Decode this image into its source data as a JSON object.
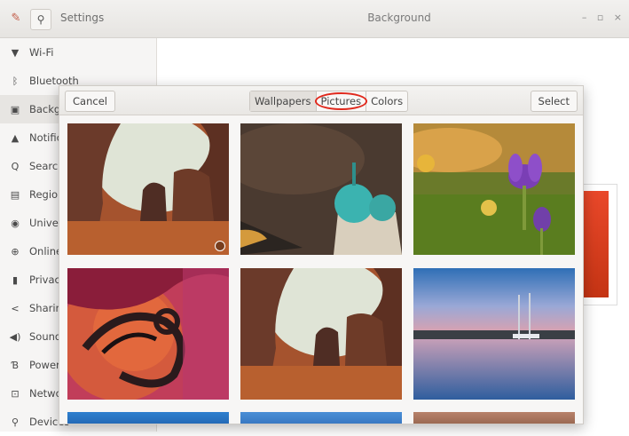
{
  "window": {
    "settings_title": "Settings",
    "title": "Background",
    "controls": "– ▫ ×"
  },
  "sidebar": {
    "items": [
      {
        "label": "Wi-Fi",
        "icon": "wifi-icon"
      },
      {
        "label": "Bluetooth",
        "icon": "bluetooth-icon"
      },
      {
        "label": "Backgr",
        "icon": "background-icon"
      },
      {
        "label": "Notific",
        "icon": "bell-icon"
      },
      {
        "label": "Search",
        "icon": "search-icon"
      },
      {
        "label": "Region",
        "icon": "keyboard-icon"
      },
      {
        "label": "Univer",
        "icon": "accessibility-icon"
      },
      {
        "label": "Online",
        "icon": "online-accounts-icon"
      },
      {
        "label": "Privacy",
        "icon": "privacy-icon"
      },
      {
        "label": "Sharing",
        "icon": "share-icon"
      },
      {
        "label": "Sound",
        "icon": "speaker-icon"
      },
      {
        "label": "Power",
        "icon": "power-icon"
      },
      {
        "label": "Netwo",
        "icon": "network-icon"
      },
      {
        "label": "Devices",
        "icon": "devices-icon"
      }
    ]
  },
  "dialog": {
    "cancel_label": "Cancel",
    "select_label": "Select",
    "tabs": [
      {
        "label": "Wallpapers",
        "selected": true
      },
      {
        "label": "Pictures",
        "highlighted": true
      },
      {
        "label": "Colors"
      }
    ],
    "thumbnails": [
      {
        "name": "desert-arch-wallpaper",
        "current": true
      },
      {
        "name": "cathedral-dome-wallpaper"
      },
      {
        "name": "purple-crocus-wallpaper"
      },
      {
        "name": "abstract-swirl-wallpaper"
      },
      {
        "name": "desert-arch-wallpaper-2"
      },
      {
        "name": "harbor-sunset-wallpaper"
      }
    ]
  },
  "colors": {
    "accent_red": "#e0281c",
    "preview_red": "#d9401f"
  }
}
